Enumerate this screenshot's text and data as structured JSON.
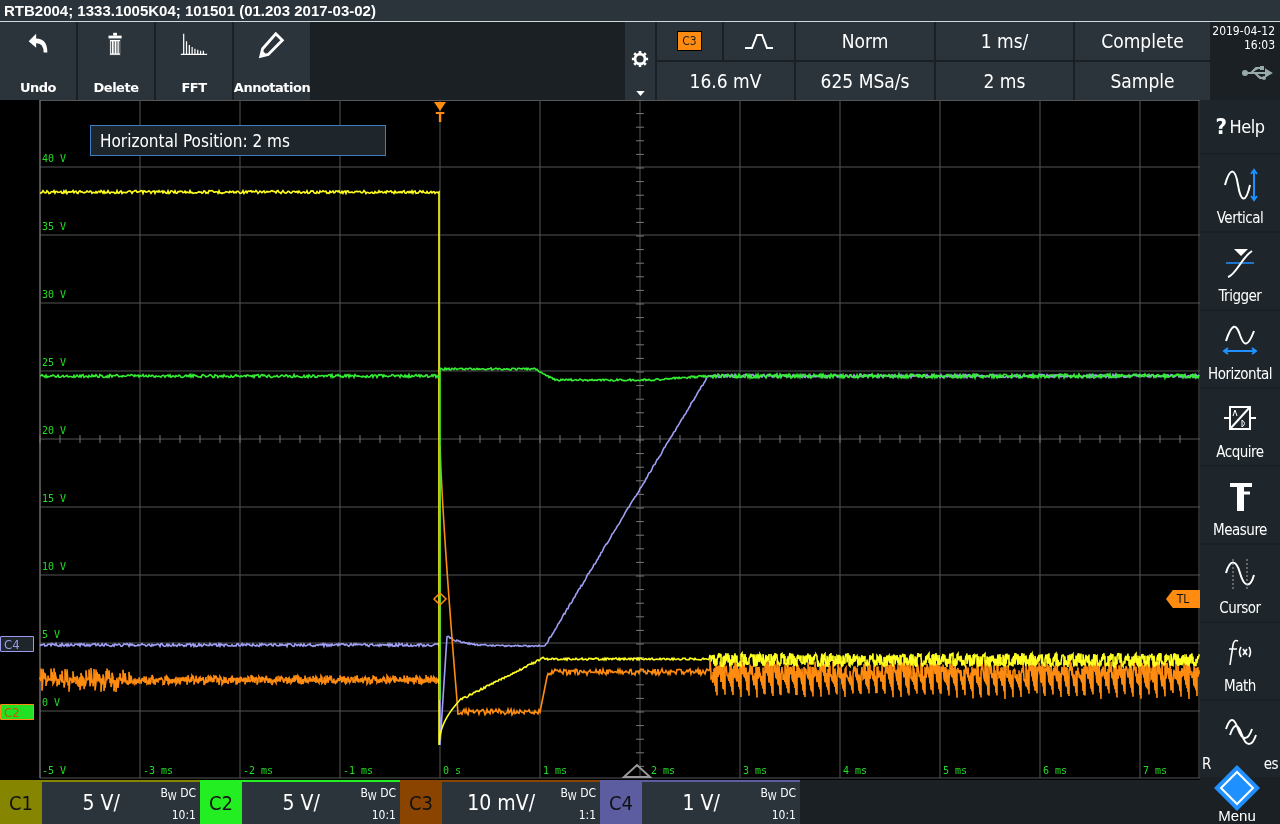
{
  "title_bar": {
    "text": "RTB2004; 1333.1005K04; 101501 (01.203 2017-03-02)"
  },
  "toolbar": {
    "buttons": [
      {
        "label": "Undo",
        "kind": "undo"
      },
      {
        "label": "Delete",
        "kind": "delete"
      },
      {
        "label": "FFT",
        "kind": "fft"
      },
      {
        "label": "Annotation",
        "kind": "annotation"
      }
    ]
  },
  "status": {
    "trigger_source": "C3",
    "trigger_level": "16.6 mV",
    "trigger_mode": "Norm",
    "sample_rate": "625 MSa/s",
    "time_scale": "1 ms/",
    "horizontal_position": "2 ms",
    "acquisition_state": "Complete",
    "acquisition_mode": "Sample",
    "date": "2019-04-12",
    "time": "16:03"
  },
  "plot": {
    "info_box": "Horizontal Position: 2 ms",
    "y_labels": [
      "40 V",
      "35 V",
      "30 V",
      "25 V",
      "20 V",
      "15 V",
      "10 V",
      "5 V",
      "0 V",
      "-5 V"
    ],
    "x_labels": [
      "-3 ms",
      "-2 ms",
      "-1 ms",
      "0 s",
      "1 ms",
      "2 ms",
      "3 ms",
      "4 ms",
      "5 ms",
      "6 ms",
      "7 ms"
    ],
    "trigger_marker": "T",
    "trigger_level_marker": "TL",
    "channel_markers": [
      {
        "label": "C4",
        "color": "#9a9af0"
      },
      {
        "label": "C2",
        "color": "#22e022"
      }
    ]
  },
  "sidebar": {
    "items": [
      {
        "label": "Help",
        "icon": "?",
        "kind": "help"
      },
      {
        "label": "Vertical",
        "kind": "vertical"
      },
      {
        "label": "Trigger",
        "kind": "trigger"
      },
      {
        "label": "Horizontal",
        "kind": "horizontal"
      },
      {
        "label": "Acquire",
        "kind": "acquire"
      },
      {
        "label": "Measure",
        "kind": "measure"
      },
      {
        "label": "Cursor",
        "kind": "cursor"
      },
      {
        "label": "Math",
        "kind": "math"
      },
      {
        "label": "R",
        "label_end": "es",
        "kind": "references"
      }
    ],
    "menu_button": {
      "label": "Menu"
    }
  },
  "channels": [
    {
      "name": "C1",
      "scale": "5 V/",
      "coupling": "B$_{W}$ DC",
      "probe": "10:1",
      "color": "#858500"
    },
    {
      "name": "C2",
      "scale": "5 V/",
      "coupling": "B$_{W}$ DC",
      "probe": "10:1",
      "color": "#22ee22"
    },
    {
      "name": "C3",
      "scale": "10 mV/",
      "coupling": "B$_{W}$ DC",
      "probe": "1:1",
      "color": "#8a4400"
    },
    {
      "name": "C4",
      "scale": "1 V/",
      "coupling": "B$_{W}$ DC",
      "probe": "10:1",
      "color": "#5c5ca0"
    }
  ]
}
